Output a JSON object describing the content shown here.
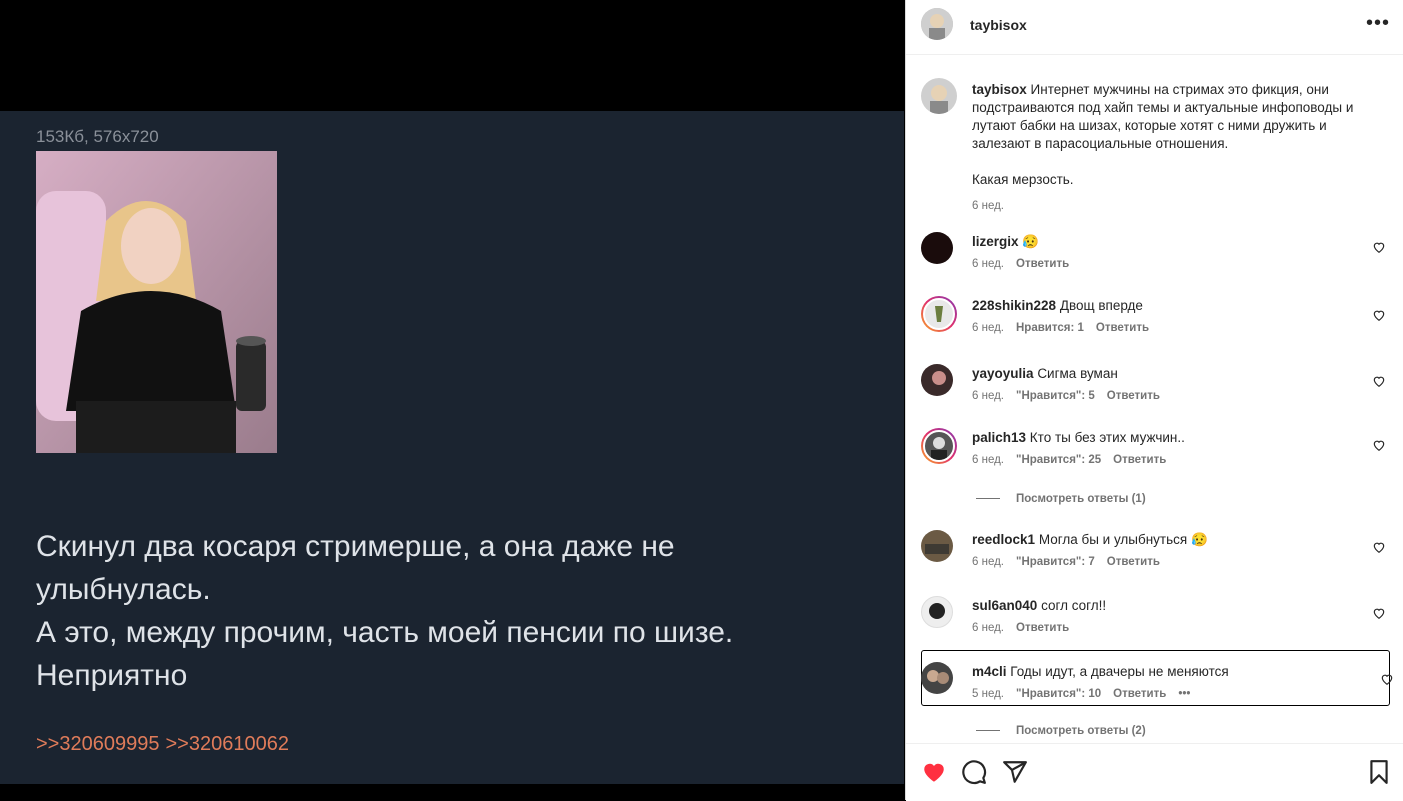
{
  "post": {
    "meta": "153Кб, 576x720",
    "text": "Скинул два косаря стримерше, а она даже не\nулыбнулась.\nА это, между прочим, часть моей пенсии по шизе.\nНеприятно",
    "replies": [
      ">>320609995",
      ">>320610062"
    ]
  },
  "header": {
    "username": "taybisox",
    "more": "•••"
  },
  "caption": {
    "username": "taybisox",
    "text1": "Интернет мужчины на стримах это фикция, они подстраиваются под хайп темы и актуальные инфоповоды и лутают бабки на шизах, которые хотят с ними дружить и залезают в парасоциальные отношения.",
    "text2": "Какая мерзость.",
    "time": "6 нед."
  },
  "comments": [
    {
      "user": "lizergix",
      "text": "😥",
      "time": "6 нед.",
      "likes": "",
      "reply": "Ответить"
    },
    {
      "user": "228shikin228",
      "text": "Двощ вперде",
      "time": "6 нед.",
      "likes": "Нравится: 1",
      "reply": "Ответить"
    },
    {
      "user": "yayoyulia",
      "text": "Сигма вуман",
      "time": "6 нед.",
      "likes": "\"Нравится\": 5",
      "reply": "Ответить"
    },
    {
      "user": "palich13",
      "text": "Кто ты без этих мужчин..",
      "time": "6 нед.",
      "likes": "\"Нравится\": 25",
      "reply": "Ответить"
    },
    {
      "user": "reedlock1",
      "text": "Могла бы и улыбнуться 😥",
      "time": "6 нед.",
      "likes": "\"Нравится\": 7",
      "reply": "Ответить"
    },
    {
      "user": "sul6an040",
      "text": "согл согл!!",
      "time": "6 нед.",
      "likes": "",
      "reply": "Ответить"
    },
    {
      "user": "m4cli",
      "text": "Годы идут, а двачеры не меняются",
      "time": "5 нед.",
      "likes": "\"Нравится\": 10",
      "reply": "Ответить",
      "more": "•••"
    }
  ],
  "view_replies": [
    "Посмотреть ответы (1)",
    "Посмотреть ответы (2)"
  ],
  "colors": {
    "like_red": "#ff3040",
    "reply_link": "#e07c5a",
    "post_bg": "#1b2430"
  },
  "icons": [
    "heart-icon",
    "comment-icon",
    "share-icon",
    "bookmark-icon"
  ]
}
